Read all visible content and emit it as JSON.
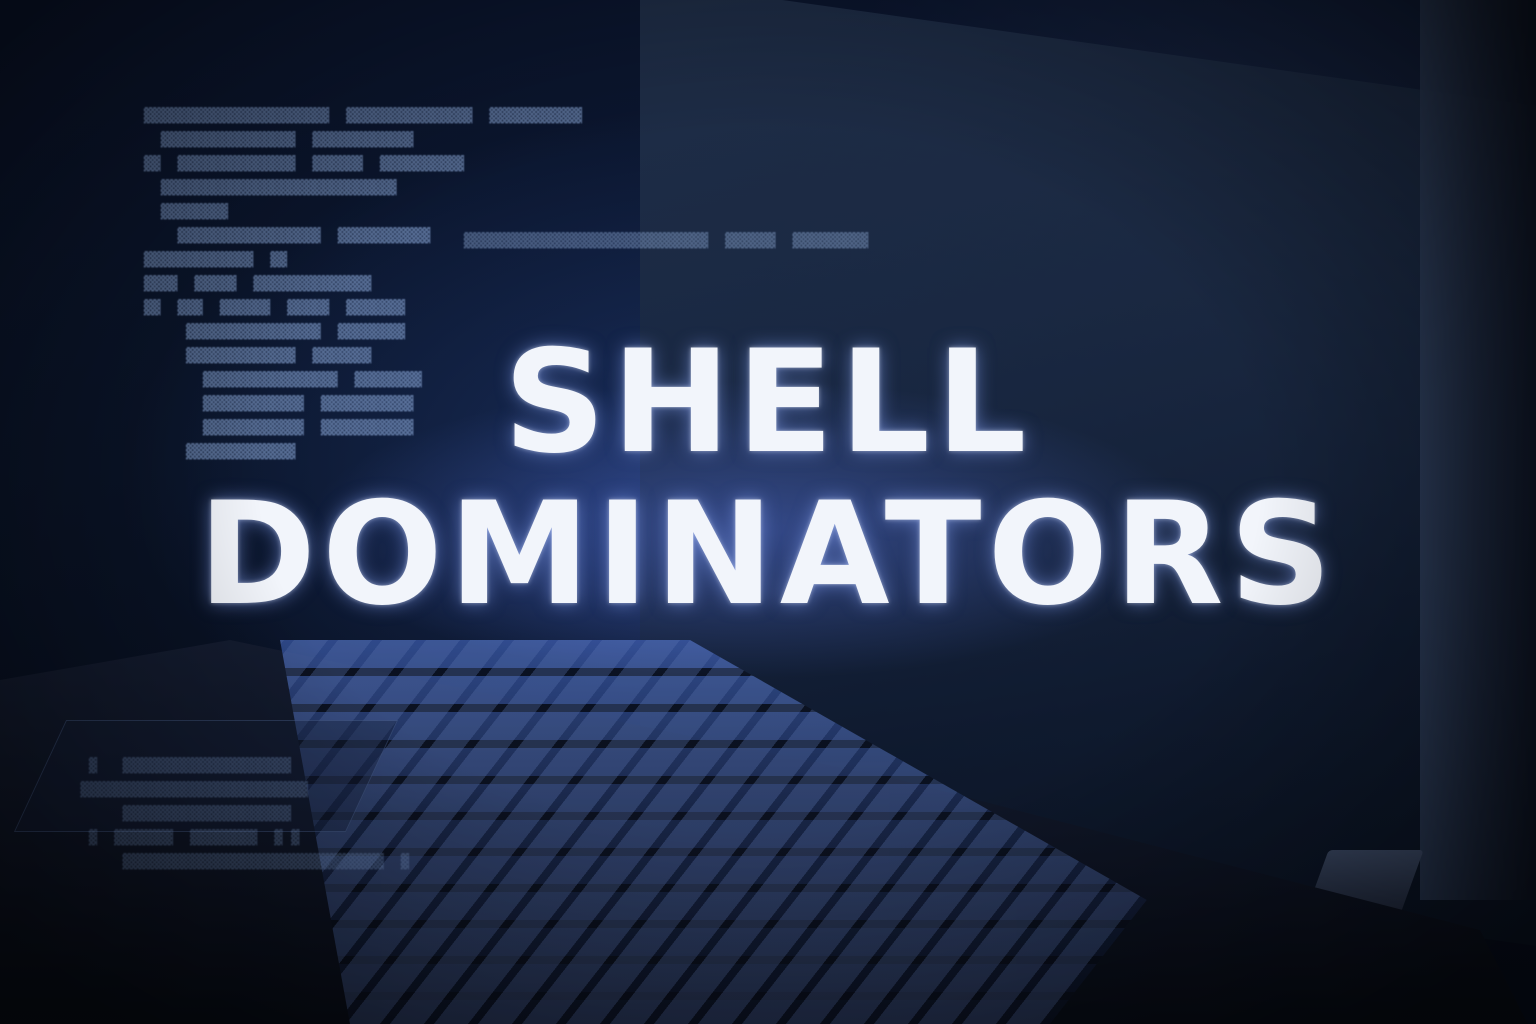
{
  "title": {
    "line1": "SHELL",
    "line2": "DOMINATORS"
  },
  "colors": {
    "background": "#0a1428",
    "title_text": "#f2f5fb",
    "glow": "#5a78e6"
  }
}
